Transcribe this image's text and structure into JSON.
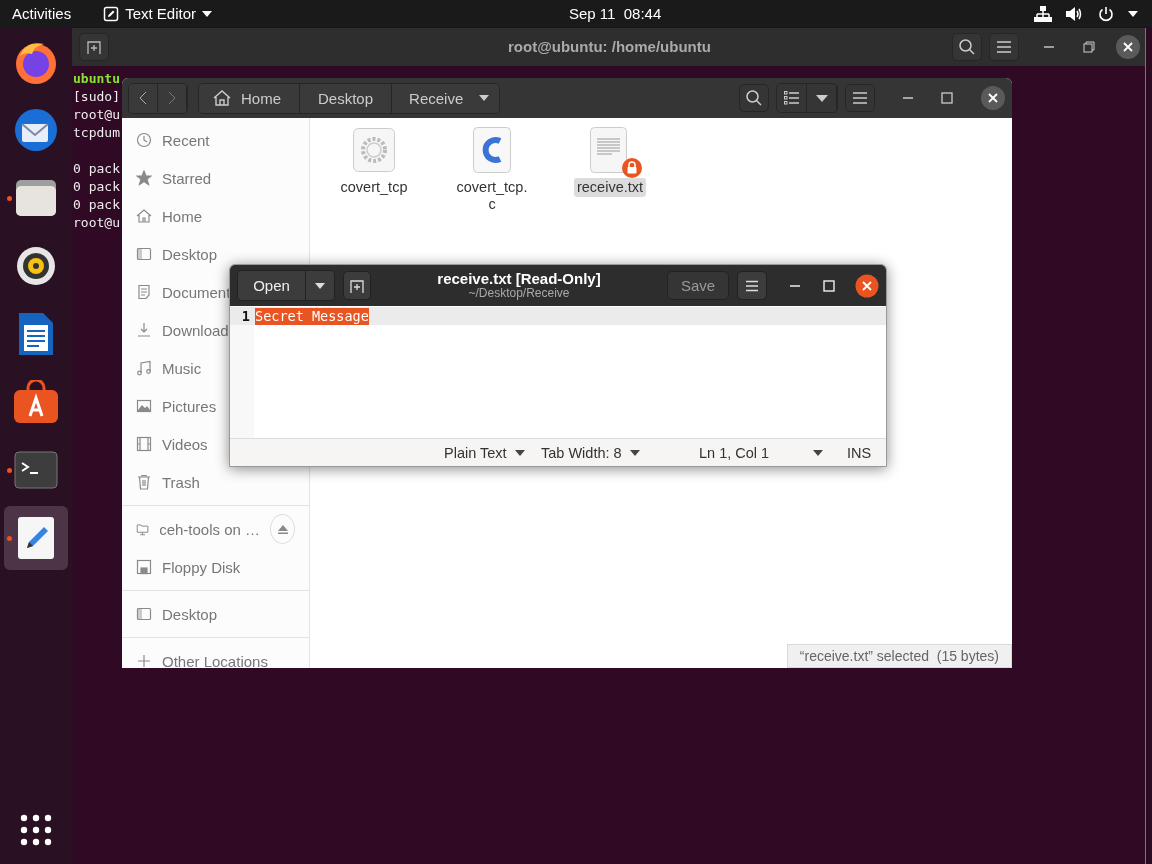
{
  "top_bar": {
    "activities": "Activities",
    "app_menu": "Text Editor",
    "clock": "Sep 11  08:44"
  },
  "dock": {
    "apps": [
      {
        "kind": "firefox",
        "running": false,
        "active": false
      },
      {
        "kind": "mail",
        "running": false,
        "active": false
      },
      {
        "kind": "files",
        "running": true,
        "active": false
      },
      {
        "kind": "music",
        "running": false,
        "active": false
      },
      {
        "kind": "writer",
        "running": false,
        "active": false
      },
      {
        "kind": "software",
        "running": false,
        "active": false
      },
      {
        "kind": "terminal",
        "running": true,
        "active": false
      },
      {
        "kind": "editor",
        "running": true,
        "active": true
      }
    ]
  },
  "terminal": {
    "title": "root@ubuntu: /home/ubuntu",
    "blocks": [
      [
        {
          "text": "ubuntu",
          "kind": "prompt"
        },
        {
          "text": "[sudo]",
          "kind": "output"
        },
        {
          "text": "root@u",
          "kind": "output"
        },
        {
          "text": "tcpdum",
          "kind": "output"
        }
      ],
      [
        {
          "text": "0 pack",
          "kind": "output"
        },
        {
          "text": "0 pack",
          "kind": "output"
        },
        {
          "text": "0 pack",
          "kind": "output"
        },
        {
          "text": "root@u",
          "kind": "output"
        }
      ]
    ]
  },
  "file_manager": {
    "path": [
      {
        "label": "Home",
        "kind": "home"
      },
      {
        "label": "Desktop",
        "kind": "folder"
      },
      {
        "label": "Receive",
        "kind": "current"
      }
    ],
    "sidebar": [
      [
        {
          "label": "Recent",
          "kind": "recent"
        },
        {
          "label": "Starred",
          "kind": "star"
        },
        {
          "label": "Home",
          "kind": "home"
        },
        {
          "label": "Desktop",
          "kind": "desktop"
        },
        {
          "label": "Document",
          "kind": "document"
        },
        {
          "label": "Download",
          "kind": "download"
        },
        {
          "label": "Music",
          "kind": "music"
        },
        {
          "label": "Pictures",
          "kind": "pictures"
        },
        {
          "label": "Videos",
          "kind": "videos"
        },
        {
          "label": "Trash",
          "kind": "trash"
        }
      ],
      [
        {
          "label": "ceh-tools on …",
          "kind": "network",
          "ejectable": true
        },
        {
          "label": "Floppy Disk",
          "kind": "floppy",
          "ejectable": false
        }
      ],
      [
        {
          "label": "Desktop",
          "kind": "desktop"
        }
      ],
      [
        {
          "label": "Other Locations",
          "kind": "plus"
        }
      ]
    ],
    "files": [
      {
        "name": "covert_tcp",
        "kind": "executable",
        "selected": false,
        "locked": false
      },
      {
        "name": "covert_tcp.c",
        "kind": "c-source",
        "selected": false,
        "locked": false
      },
      {
        "name": "receive.txt",
        "kind": "text",
        "selected": true,
        "locked": true
      }
    ],
    "status": "“receive.txt” selected  (15 bytes)"
  },
  "editor": {
    "open": "Open",
    "title": "receive.txt [Read-Only]",
    "subtitle": "~/Desktop/Receive",
    "save": "Save",
    "save_disabled": true,
    "lines": [
      {
        "number": "1",
        "text": "Secret Message",
        "selected": true,
        "current": true
      }
    ],
    "status": {
      "language": "Plain Text",
      "tab_width": "Tab Width: 8",
      "position": "Ln 1, Col 1",
      "mode": "INS"
    }
  }
}
